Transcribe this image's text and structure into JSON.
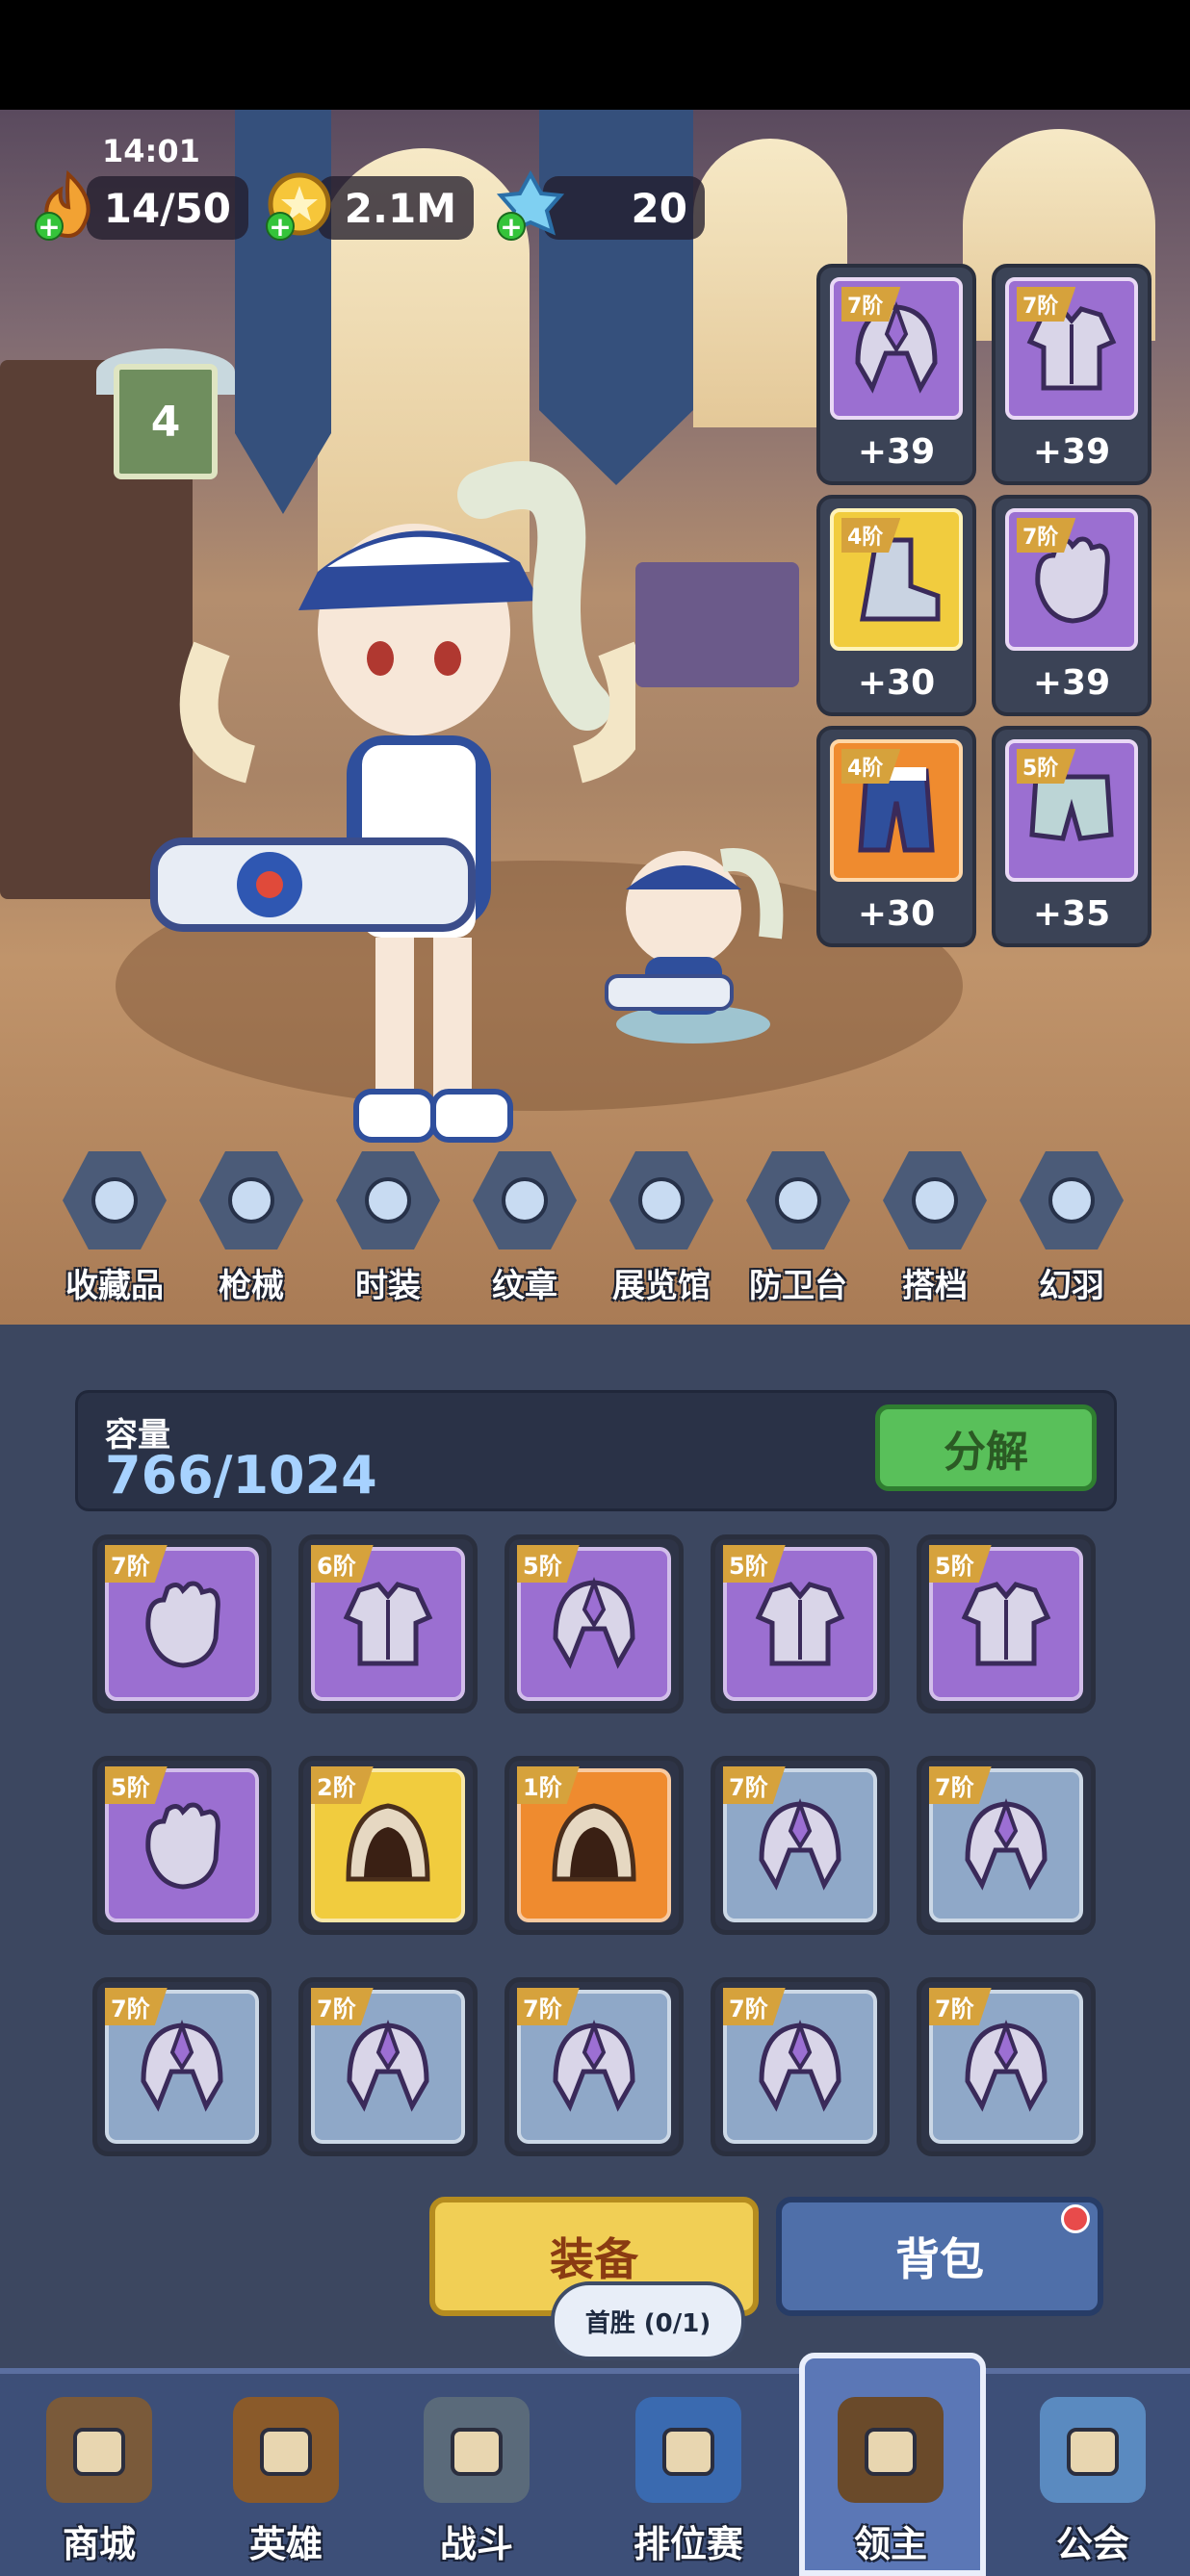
{
  "status": {
    "time": "14:01"
  },
  "resources": [
    {
      "icon": "flame-icon",
      "value": "14/50"
    },
    {
      "icon": "coin-icon",
      "value": "2.1M"
    },
    {
      "icon": "crystal-icon",
      "value": "20"
    }
  ],
  "rank_badge": {
    "value": "4"
  },
  "equipped": [
    {
      "tier": "7阶",
      "bonus": "+39",
      "icon": "helmet-icon",
      "color": "purple"
    },
    {
      "tier": "7阶",
      "bonus": "+39",
      "icon": "armor-icon",
      "color": "purple"
    },
    {
      "tier": "4阶",
      "bonus": "+30",
      "icon": "boot-icon",
      "color": "gold"
    },
    {
      "tier": "7阶",
      "bonus": "+39",
      "icon": "glove-icon",
      "color": "purple"
    },
    {
      "tier": "4阶",
      "bonus": "+30",
      "icon": "pants-icon",
      "color": "orange"
    },
    {
      "tier": "5阶",
      "bonus": "+35",
      "icon": "shorts-icon",
      "color": "purple"
    }
  ],
  "features": [
    {
      "label": "收藏品",
      "icon": "feather-quill-icon"
    },
    {
      "label": "枪械",
      "icon": "gun-icon"
    },
    {
      "label": "时装",
      "icon": "jacket-icon"
    },
    {
      "label": "纹章",
      "icon": "emblem-icon"
    },
    {
      "label": "展览馆",
      "icon": "crown-hall-icon"
    },
    {
      "label": "防卫台",
      "icon": "turret-icon"
    },
    {
      "label": "搭档",
      "icon": "partner-icon"
    },
    {
      "label": "幻羽",
      "icon": "wing-icon"
    }
  ],
  "capacity": {
    "label": "容量",
    "value": "766/1024",
    "decompose_label": "分解"
  },
  "inventory": [
    {
      "tier": "7阶",
      "icon": "glove-icon",
      "color": "purple"
    },
    {
      "tier": "6阶",
      "icon": "armor-icon",
      "color": "purple"
    },
    {
      "tier": "5阶",
      "icon": "helmet-icon",
      "color": "purple"
    },
    {
      "tier": "5阶",
      "icon": "armor-icon",
      "color": "purple"
    },
    {
      "tier": "5阶",
      "icon": "armor-icon",
      "color": "purple"
    },
    {
      "tier": "5阶",
      "icon": "glove-icon",
      "color": "purple"
    },
    {
      "tier": "2阶",
      "icon": "hood-icon",
      "color": "gold"
    },
    {
      "tier": "1阶",
      "icon": "hood-icon",
      "color": "orange"
    },
    {
      "tier": "7阶",
      "icon": "helmet-icon",
      "color": "blue"
    },
    {
      "tier": "7阶",
      "icon": "helmet-icon",
      "color": "blue"
    },
    {
      "tier": "7阶",
      "icon": "helmet-icon",
      "color": "blue"
    },
    {
      "tier": "7阶",
      "icon": "helmet-icon",
      "color": "blue"
    },
    {
      "tier": "7阶",
      "icon": "helmet-icon",
      "color": "blue"
    },
    {
      "tier": "7阶",
      "icon": "helmet-icon",
      "color": "blue"
    },
    {
      "tier": "7阶",
      "icon": "helmet-icon",
      "color": "blue"
    }
  ],
  "actions": {
    "equip_label": "装备",
    "bag_label": "背包",
    "tooltip": "首胜 (0/1)"
  },
  "nav": [
    {
      "label": "商城",
      "icon": "shop-chest-icon"
    },
    {
      "label": "英雄",
      "icon": "hero-card-icon"
    },
    {
      "label": "战斗",
      "icon": "battle-icon"
    },
    {
      "label": "排位赛",
      "icon": "ranked-shield-icon"
    },
    {
      "label": "领主",
      "icon": "lord-banner-icon"
    },
    {
      "label": "公会",
      "icon": "guild-castle-icon"
    }
  ],
  "colors": {
    "purple": "#9b6fd1",
    "gold": "#f1cc3e",
    "orange": "#ef8b2f",
    "blue": "#8fa8c8",
    "accent_green": "#59c05a"
  }
}
